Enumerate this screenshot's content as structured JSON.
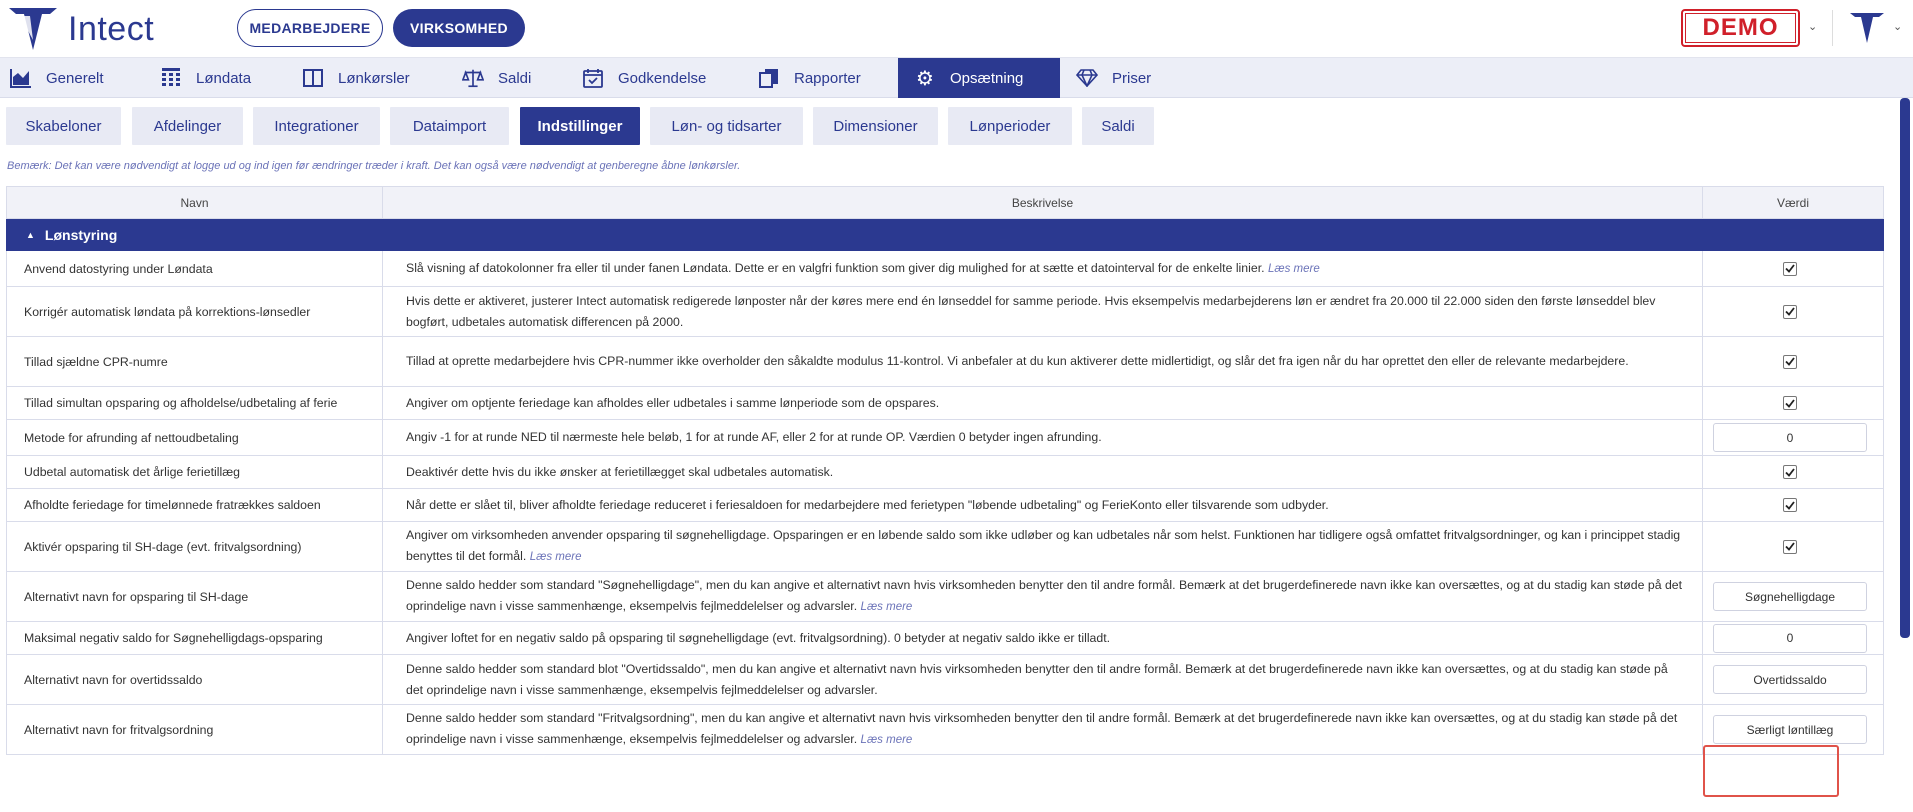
{
  "app": {
    "brand": "Intect",
    "demo_badge": "DEMO"
  },
  "header": {
    "employees_label": "MEDARBEJDERE",
    "company_label": "VIRKSOMHED"
  },
  "main_tabs": [
    {
      "label": "Generelt",
      "icon": "chart-icon"
    },
    {
      "label": "Løndata",
      "icon": "table-icon"
    },
    {
      "label": "Lønkørsler",
      "icon": "columns-icon"
    },
    {
      "label": "Saldi",
      "icon": "scale-icon"
    },
    {
      "label": "Godkendelse",
      "icon": "calendar-check-icon"
    },
    {
      "label": "Rapporter",
      "icon": "copy-icon"
    },
    {
      "label": "Opsætning",
      "icon": "gear-icon",
      "active": true
    },
    {
      "label": "Priser",
      "icon": "diamond-icon"
    }
  ],
  "sub_tabs": [
    {
      "label": "Skabeloner"
    },
    {
      "label": "Afdelinger"
    },
    {
      "label": "Integrationer"
    },
    {
      "label": "Dataimport"
    },
    {
      "label": "Indstillinger",
      "active": true
    },
    {
      "label": "Løn- og tidsarter"
    },
    {
      "label": "Dimensioner"
    },
    {
      "label": "Lønperioder"
    },
    {
      "label": "Saldi"
    }
  ],
  "note": "Bemærk: Det kan være nødvendigt at logge ud og ind igen før ændringer træder i kraft. Det kan også være nødvendigt at genberegne åbne lønkørsler.",
  "table": {
    "headers": {
      "name": "Navn",
      "description": "Beskrivelse",
      "value": "Værdi"
    },
    "section_title": "Lønstyring",
    "read_more": "Læs mere",
    "rows": [
      {
        "name": "Anvend datostyring under Løndata",
        "description": "Slå visning af datokolonner fra eller til under fanen Løndata. Dette er en valgfri funktion som giver dig mulighed for at sætte et datointerval for de enkelte linier.",
        "read_more": true,
        "type": "checkbox",
        "checked": true
      },
      {
        "name": "Korrigér automatisk løndata på korrektions-lønsedler",
        "description": "Hvis dette er aktiveret, justerer Intect automatisk redigerede lønposter når der køres mere end én lønseddel for samme periode. Hvis eksempelvis medarbejderens løn er ændret fra 20.000 til 22.000 siden den første lønseddel blev bogført, udbetales automatisk differencen på 2000.",
        "read_more": false,
        "type": "checkbox",
        "checked": true
      },
      {
        "name": "Tillad sjældne CPR-numre",
        "description": "Tillad at oprette medarbejdere hvis CPR-nummer ikke overholder den såkaldte modulus 11-kontrol. Vi anbefaler at du kun aktiverer dette midlertidigt, og slår det fra igen når du har oprettet den eller de relevante medarbejdere.",
        "read_more": false,
        "type": "checkbox",
        "checked": true
      },
      {
        "name": "Tillad simultan opsparing og afholdelse/udbetaling af ferie",
        "description": "Angiver om optjente feriedage kan afholdes eller udbetales i samme lønperiode som de opspares.",
        "read_more": false,
        "type": "checkbox",
        "checked": true
      },
      {
        "name": "Metode for afrunding af nettoudbetaling",
        "description": "Angiv -1 for at runde NED til nærmeste hele beløb, 1 for at runde AF, eller 2 for at runde OP. Værdien 0 betyder ingen afrunding.",
        "read_more": false,
        "type": "input",
        "value": "0"
      },
      {
        "name": "Udbetal automatisk det årlige ferietillæg",
        "description": "Deaktivér dette hvis du ikke ønsker at ferietillægget skal udbetales automatisk.",
        "read_more": false,
        "type": "checkbox",
        "checked": true
      },
      {
        "name": "Afholdte feriedage for timelønnede fratrækkes saldoen",
        "description": "Når dette er slået til, bliver afholdte feriedage reduceret i feriesaldoen for medarbejdere med ferietypen \"løbende udbetaling\" og FerieKonto eller tilsvarende som udbyder.",
        "read_more": false,
        "type": "checkbox",
        "checked": true
      },
      {
        "name": "Aktivér opsparing til SH-dage (evt. fritvalgsordning)",
        "description": "Angiver om virksomheden anvender opsparing til søgnehelligdage. Opsparingen er en løbende saldo som ikke udløber og kan udbetales når som helst. Funktionen har tidligere også omfattet fritvalgsordninger, og kan i princippet stadig benyttes til det formål.",
        "read_more": true,
        "type": "checkbox",
        "checked": true
      },
      {
        "name": "Alternativt navn for opsparing til SH-dage",
        "description": "Denne saldo hedder som standard \"Søgnehelligdage\", men du kan angive et alternativt navn hvis virksomheden benytter den til andre formål. Bemærk at det brugerdefinerede navn ikke kan oversættes, og at du stadig kan støde på det oprindelige navn i visse sammenhænge, eksempelvis fejlmeddelelser og advarsler.",
        "read_more": true,
        "type": "input",
        "value": "Søgnehelligdage"
      },
      {
        "name": "Maksimal negativ saldo for Søgnehelligdags-opsparing",
        "description": "Angiver loftet for en negativ saldo på opsparing til søgnehelligdage (evt. fritvalgsordning). 0 betyder at negativ saldo ikke er tilladt.",
        "read_more": false,
        "type": "input",
        "value": "0"
      },
      {
        "name": "Alternativt navn for overtidssaldo",
        "description": "Denne saldo hedder som standard blot \"Overtidssaldo\", men du kan angive et alternativt navn hvis virksomheden benytter den til andre formål. Bemærk at det brugerdefinerede navn ikke kan oversættes, og at du stadig kan støde på det oprindelige navn i visse sammenhænge, eksempelvis fejlmeddelelser og advarsler.",
        "read_more": false,
        "type": "input",
        "value": "Overtidssaldo"
      },
      {
        "name": "Alternativt navn for fritvalgsordning",
        "description": "Denne saldo hedder som standard \"Fritvalgsordning\", men du kan angive et alternativt navn hvis virksomheden benytter den til andre formål. Bemærk at det brugerdefinerede navn ikke kan oversættes, og at du stadig kan støde på det oprindelige navn i visse sammenhænge, eksempelvis fejlmeddelelser og advarsler.",
        "read_more": true,
        "type": "input",
        "value": "Særligt løntillæg"
      }
    ]
  },
  "colors": {
    "brand": "#2b3990",
    "demo": "#d0202a",
    "highlight": "#e0534a"
  }
}
